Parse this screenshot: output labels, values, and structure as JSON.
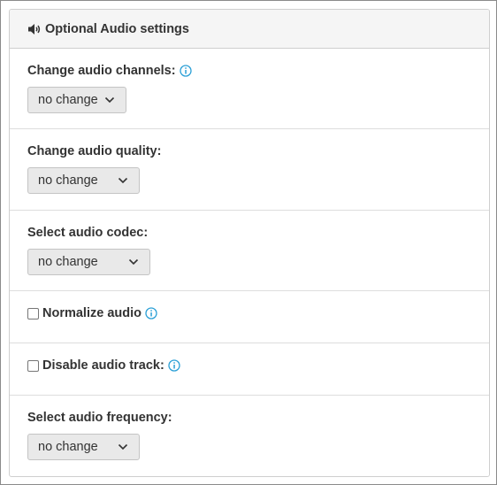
{
  "panel": {
    "title": "Optional Audio settings",
    "header_icon": "speaker-volume-icon"
  },
  "sections": {
    "channels": {
      "label": "Change audio channels:",
      "value": "no change",
      "has_info": true
    },
    "quality": {
      "label": "Change audio quality:",
      "value": "no change",
      "has_info": false
    },
    "codec": {
      "label": "Select audio codec:",
      "value": "no change",
      "has_info": false
    },
    "normalize": {
      "label": "Normalize audio",
      "checked": false,
      "has_info": true
    },
    "disable_track": {
      "label": "Disable audio track:",
      "checked": false,
      "has_info": true
    },
    "frequency": {
      "label": "Select audio frequency:",
      "value": "no change",
      "has_info": false
    }
  },
  "colors": {
    "info_icon": "#2a9fd6",
    "select_bg": "#e9e9e9",
    "header_bg": "#f5f5f5"
  }
}
